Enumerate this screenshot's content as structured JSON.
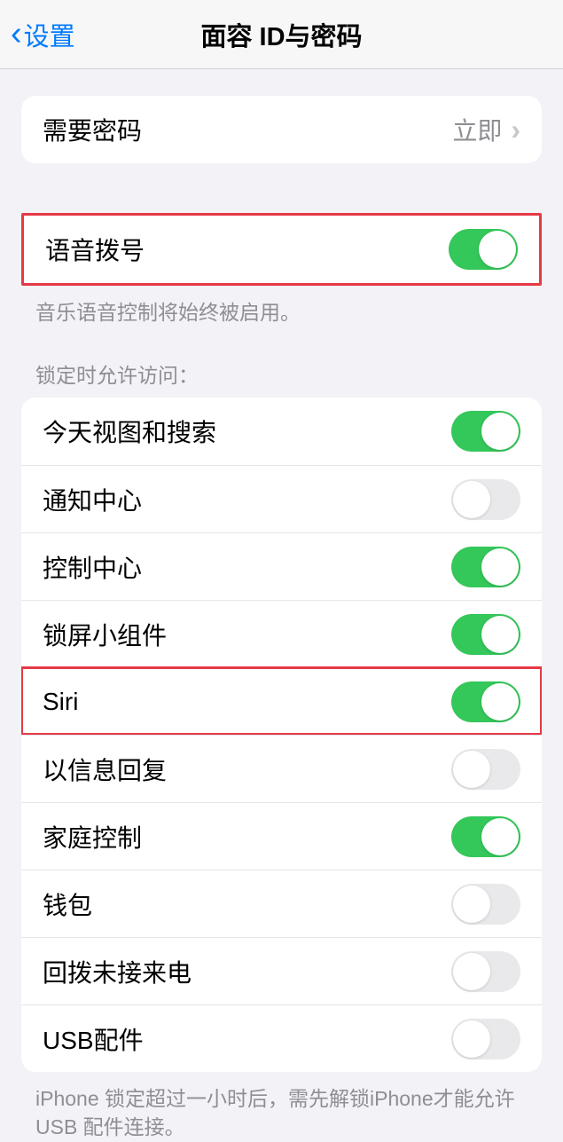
{
  "nav": {
    "back_label": "设置",
    "title": "面容 ID与密码"
  },
  "require_passcode": {
    "label": "需要密码",
    "value": "立即"
  },
  "voice_dial": {
    "label": "语音拨号",
    "on": true,
    "footer": "音乐语音控制将始终被启用。"
  },
  "allow_access_header": "锁定时允许访问：",
  "allow_access": [
    {
      "label": "今天视图和搜索",
      "on": true
    },
    {
      "label": "通知中心",
      "on": false
    },
    {
      "label": "控制中心",
      "on": true
    },
    {
      "label": "锁屏小组件",
      "on": true
    },
    {
      "label": "Siri",
      "on": true
    },
    {
      "label": "以信息回复",
      "on": false
    },
    {
      "label": "家庭控制",
      "on": true
    },
    {
      "label": "钱包",
      "on": false
    },
    {
      "label": "回拨未接来电",
      "on": false
    },
    {
      "label": "USB配件",
      "on": false
    }
  ],
  "usb_footer": "iPhone 锁定超过一小时后，需先解锁iPhone才能允许USB 配件连接。"
}
